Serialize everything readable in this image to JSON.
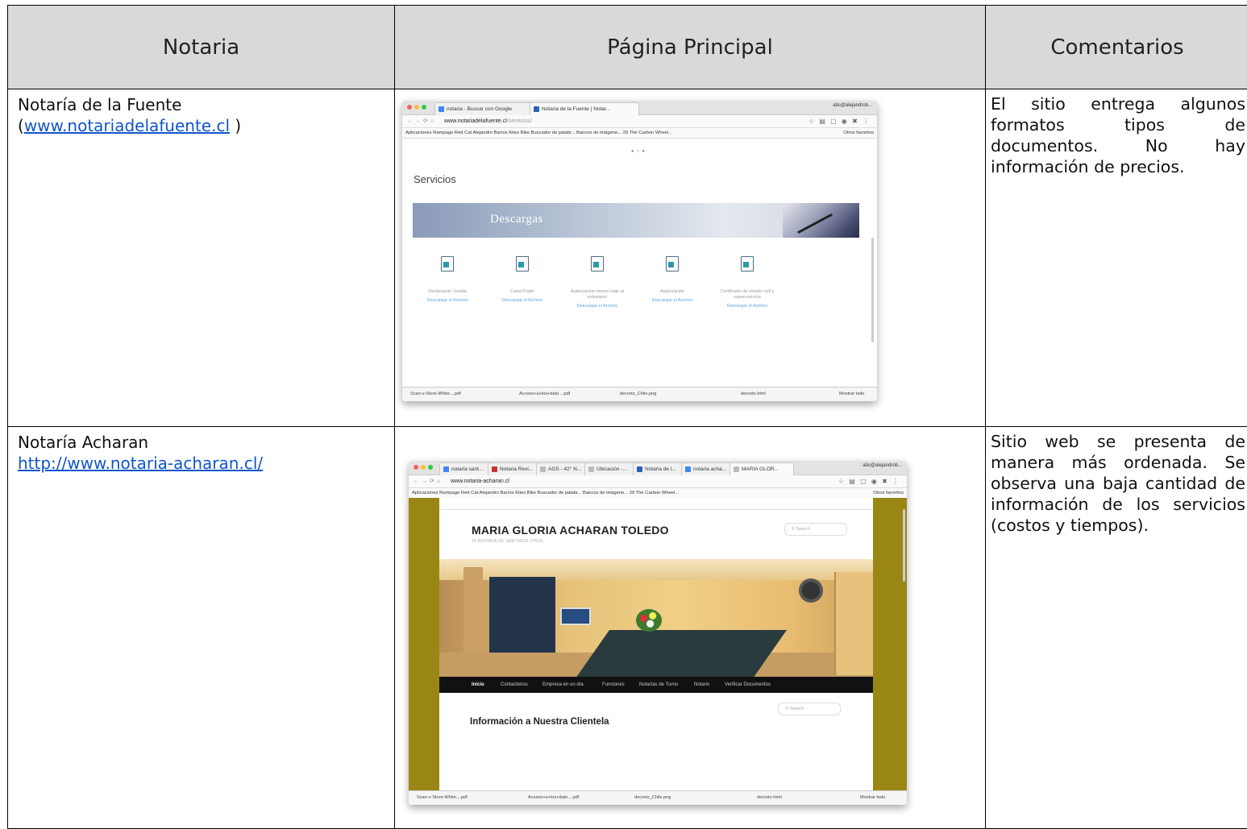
{
  "table": {
    "headers": [
      "Notaria",
      "Página Principal",
      "Comentarios"
    ],
    "rows": [
      {
        "name": "Notaría de la Fuente",
        "url_prefix": "(",
        "url": "www.notariadelafuente.cl",
        "url_suffix": " )",
        "comment": "El sitio entrega algunos formatos tipos de documentos. No hay información de precios."
      },
      {
        "name": "Notaría Acharan",
        "url": "http://www.notaria-acharan.cl/",
        "comment": "Sitio web se presenta de manera más ordenada. Se observa una baja cantidad de información de los servicios (costos y tiempos)."
      }
    ]
  },
  "browser1": {
    "tabs": [
      "notaria - Buscar con Google",
      "Notaria de la Fuente | Notar..."
    ],
    "user": "abc@alejandrob...",
    "url": "www.notariadelafuente.cl",
    "url_path": "/servicios/",
    "bookmarks": "Aplicaciones   Rampage Red Cat   Alejandro Barros   Kites   Bike   Buscador de palabr...   Bancos de imágene...   29 The Carbon Wheel...",
    "other_bookmarks": "Otros favoritos",
    "section": "Servicios",
    "banner": "Descargas",
    "docs": [
      {
        "name": "Declaración Jurada",
        "link": "Descargar el Archivo"
      },
      {
        "name": "Carta Poder",
        "link": "Descargar el Archivo"
      },
      {
        "name": "Autorización menor viaje al extranjero",
        "link": "Descargar el Archivo"
      },
      {
        "name": "Autorización",
        "link": "Descargar el Archivo"
      },
      {
        "name": "Certificado de estado civil y supervivencia",
        "link": "Descargar el Archivo"
      }
    ],
    "downloads": [
      "Scan-v-Store-White....pdf",
      "Acceso+a+los+dato....pdf",
      "decreto_Chile.png",
      "decreto.html"
    ],
    "show_all": "Mostrar todo"
  },
  "browser2": {
    "tabs": [
      "notaria sant...",
      "Notaria Revi...",
      "AGS - 42° N...",
      "Ubicación -...",
      "Notaria de l...",
      "notaria acha...",
      "MARIA GLOR..."
    ],
    "user": "abc@alejandrob...",
    "url": "www.notaria-acharan.cl",
    "bookmarks": "Aplicaciones   Rampage Red Cat   Alejandro Barros   Kites   Bike   Buscador de palabr...   Bancos de imágene...   29 The Carbon Wheel...",
    "other_bookmarks": "Otros favoritos",
    "site_title": "MARIA GLORIA ACHARAN TOLEDO",
    "site_subtitle": "15 NOTARIA DE SANTIAGO CHILE",
    "search_placeholder": "Search",
    "menu": [
      "Inicio",
      "Contactenos",
      "Empresa en un día",
      "Funciones",
      "Notarías de Turno",
      "Notario",
      "Verificar Documentos"
    ],
    "section_title": "Información a Nuestra Clientela",
    "downloads": [
      "Scan-v-Store-White....pdf",
      "Acceso+a+los+dato....pdf",
      "decreto_Chile.png",
      "decreto.html"
    ],
    "show_all": "Mostrar todo"
  }
}
